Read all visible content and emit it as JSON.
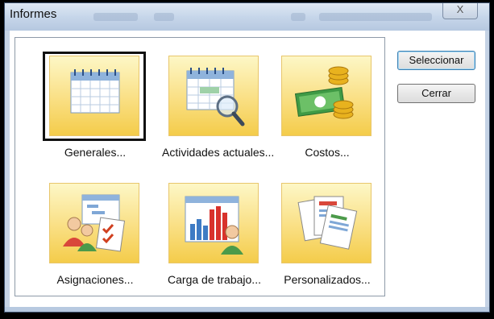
{
  "window": {
    "title": "Informes",
    "close_glyph": "X"
  },
  "tiles": [
    {
      "label": "Generales...",
      "icon": "calendar-icon",
      "selected": true
    },
    {
      "label": "Actividades actuales...",
      "icon": "calendar-magnifier-icon",
      "selected": false
    },
    {
      "label": "Costos...",
      "icon": "money-coins-icon",
      "selected": false
    },
    {
      "label": "Asignaciones...",
      "icon": "people-assignments-icon",
      "selected": false
    },
    {
      "label": "Carga de trabajo...",
      "icon": "workload-chart-icon",
      "selected": false
    },
    {
      "label": "Personalizados...",
      "icon": "custom-reports-icon",
      "selected": false
    }
  ],
  "buttons": {
    "select_label": "Seleccionar",
    "close_label": "Cerrar"
  },
  "colors": {
    "tile_top": "#fdf7c6",
    "tile_bottom": "#f4cc4a",
    "titlebar": "#c6d6ea"
  }
}
